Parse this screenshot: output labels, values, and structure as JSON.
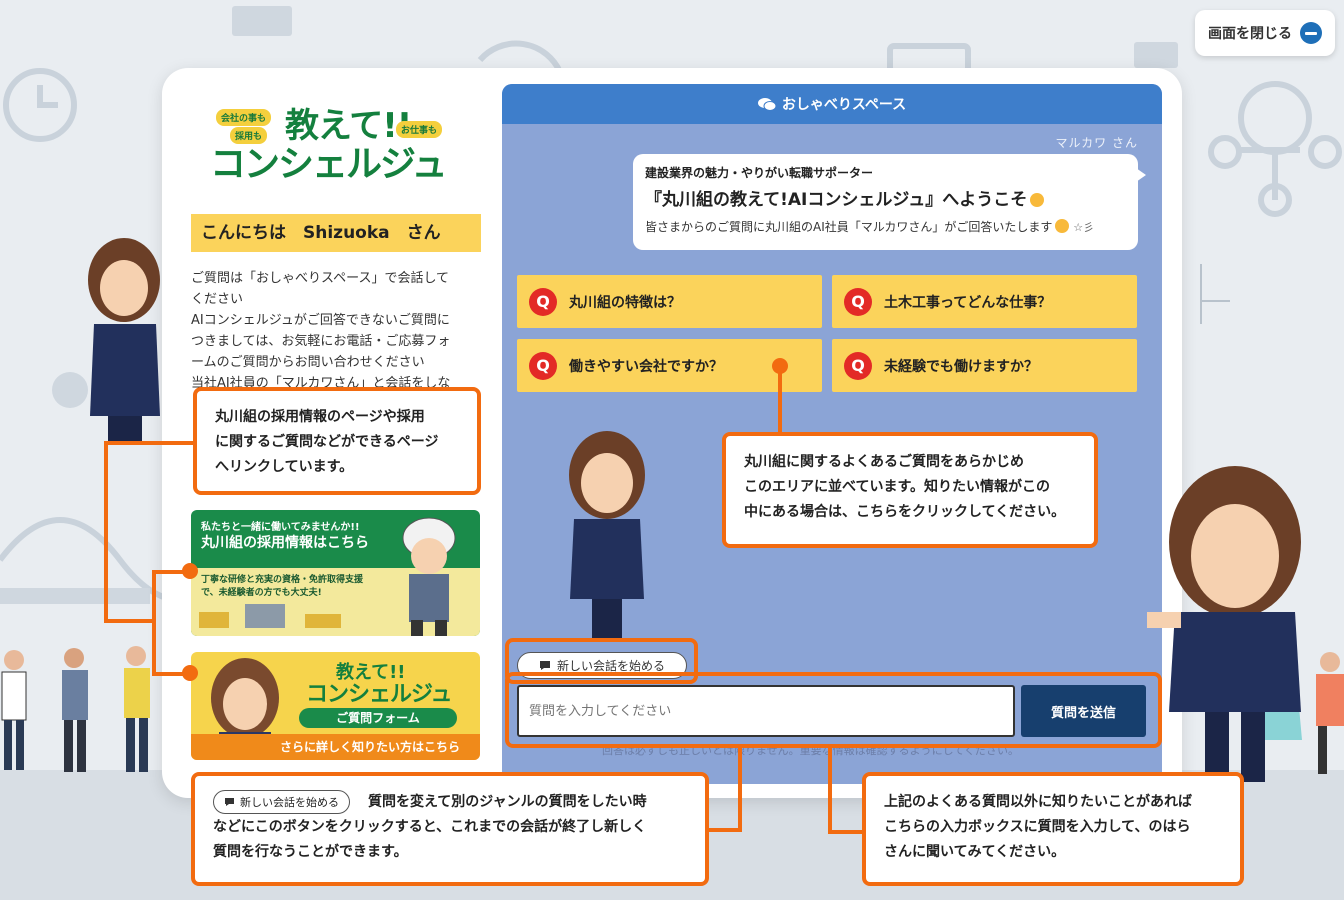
{
  "close_button": {
    "label": "画面を閉じる"
  },
  "logo": {
    "tag1": "会社の事も",
    "tag2": "採用も",
    "tag3": "お仕事も",
    "title1": "教えて!!",
    "title2": "コンシェルジュ"
  },
  "sidebar": {
    "greeting": "こんにちは　Shizuoka　さん",
    "intro": "ご質問は「おしゃべりスペース」で会話して\nください\nAIコンシェルジュがご回答できないご質問に\nつきましては、お気軽にお電話・ご応募フォ\nームのご質問からお問い合わせください\n当社AI社員の「マルカワさん」と会話をしな",
    "recruit_banner": {
      "line1": "私たちと一緒に働いてみませんか!!",
      "line2": "丸川組の採用情報はこちら",
      "line3": "丁寧な研修と充実の資格・免許取得支援で、未経験者の方でも大丈夫!"
    },
    "concierge_banner": {
      "title1": "教えて!!",
      "title2": "コンシェルジュ",
      "pill": "ご質問フォーム",
      "footer": "さらに詳しく知りたい方はこちら"
    }
  },
  "chat": {
    "header": "おしゃべりスペース",
    "speaker": "マルカワ さん",
    "bubble": {
      "line1": "建設業界の魅力・やりがい転職サポーター",
      "line2": "『丸川組の教えて!AIコンシェルジュ』へようこそ",
      "line3": "皆さまからのご質問に丸川組のAI社員「マルカワさん」がご回答いたします"
    },
    "faq_mark": "Q",
    "faqs": [
      "丸川組の特徴は？",
      "土木工事ってどんな仕事？",
      "働きやすい会社ですか？",
      "未経験でも働けますか？"
    ],
    "new_chat": "新しい会話を始める",
    "input_placeholder": "質問を入力してください",
    "send": "質問を送信",
    "disclaimer": "回答は必ずしも正しいとは限りません。重要な情報は確認するようにしてください。"
  },
  "callouts": {
    "recruit": "丸川組の採用情報のページや採用\nに関するご質問などができるページ\nへリンクしています。",
    "faq": "丸川組に関するよくあるご質問をあらかじめ\nこのエリアに並べています。知りたい情報がこの\n中にある場合は、こちらをクリックしてください。",
    "new_chat_chip": "新しい会話を始める",
    "new_chat": "質問を変えて別のジャンルの質問をしたい時\nなどにこのボタンをクリックすると、これまでの会話が終了し新しく\n質問を行なうことができます。",
    "input": "上記のよくある質問以外に知りたいことがあれば\nこちらの入力ボックスに質問を入力して、のはら\nさんに聞いてみてください。"
  },
  "colors": {
    "accent_orange": "#f26b10",
    "faq_yellow": "#fbd35b",
    "chat_bg": "#8ba4d6",
    "header_blue": "#3e7ecb",
    "send_navy": "#173f6e",
    "brand_green": "#14803e"
  }
}
